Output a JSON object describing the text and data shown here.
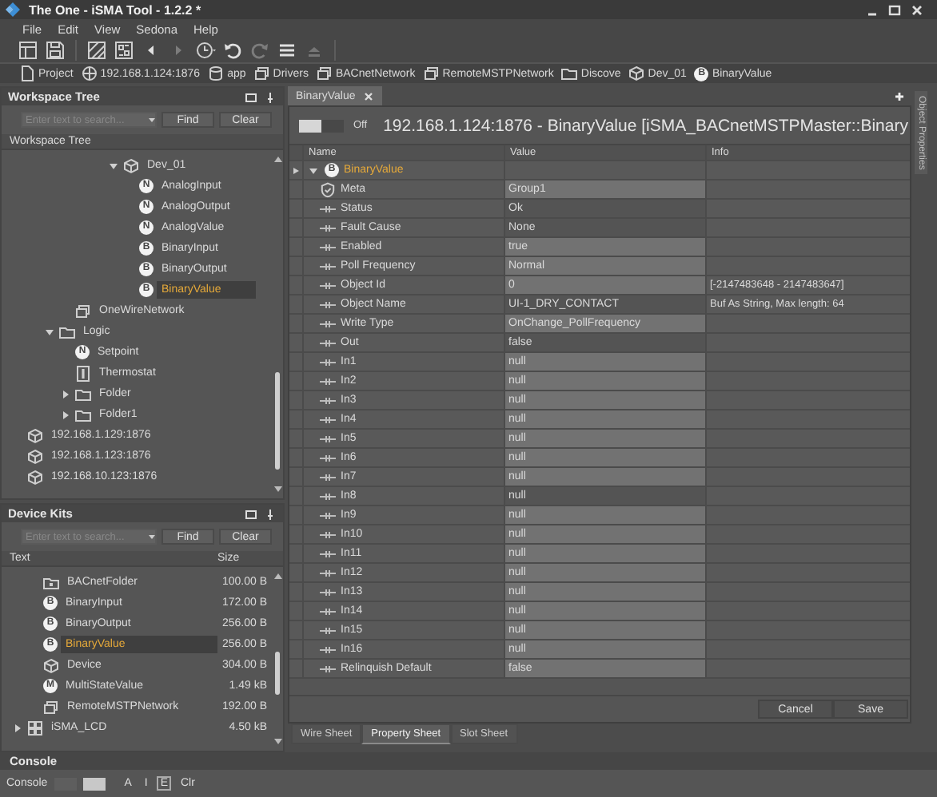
{
  "window": {
    "title": "The One - iSMA Tool - 1.2.2 *"
  },
  "menu": [
    "File",
    "Edit",
    "View",
    "Sedona",
    "Help"
  ],
  "toolbar": [
    [
      {
        "kind": "layout",
        "disabled": false
      },
      {
        "kind": "save",
        "disabled": false
      }
    ],
    [
      {
        "kind": "hatch",
        "disabled": false
      },
      {
        "kind": "chip",
        "disabled": false
      },
      {
        "kind": "back",
        "disabled": false
      },
      {
        "kind": "forward",
        "disabled": true
      },
      {
        "kind": "history",
        "disabled": false
      },
      {
        "kind": "undo",
        "disabled": false
      },
      {
        "kind": "redo",
        "disabled": true
      },
      {
        "kind": "list",
        "disabled": false
      },
      {
        "kind": "eject",
        "disabled": true
      }
    ]
  ],
  "breadcrumb": [
    {
      "kind": "page",
      "label": "Project"
    },
    {
      "kind": "station",
      "label": "192.168.1.124:1876"
    },
    {
      "kind": "database",
      "label": "app"
    },
    {
      "kind": "stack",
      "label": "Drivers"
    },
    {
      "kind": "stack",
      "label": "BACnetNetwork"
    },
    {
      "kind": "stack",
      "label": "RemoteMSTPNetwork"
    },
    {
      "kind": "folder",
      "label": "Discove"
    },
    {
      "kind": "device",
      "label": "Dev_01"
    },
    {
      "badge": "B",
      "label": "BinaryValue"
    }
  ],
  "workspace": {
    "title": "Workspace Tree",
    "search": {
      "placeholder": "Enter text to search..."
    },
    "find": "Find",
    "clear": "Clear",
    "column": "Workspace Tree",
    "tree": [
      {
        "children": [
          {
            "children": [
              {
                "children": [
                  {
                    "children": [
                      {
                        "children": [
                          {
                            "children": [
                              {
                                "label": "Dev_01",
                                "kind": "device",
                                "expanded": true,
                                "selected": false,
                                "children": [
                                  {
                                    "label": "AnalogInput",
                                    "badge": "N",
                                    "selected": false
                                  },
                                  {
                                    "label": "AnalogOutput",
                                    "badge": "N",
                                    "selected": false
                                  },
                                  {
                                    "label": "AnalogValue",
                                    "badge": "N",
                                    "selected": false
                                  },
                                  {
                                    "label": "BinaryInput",
                                    "badge": "B",
                                    "selected": false
                                  },
                                  {
                                    "label": "BinaryOutput",
                                    "badge": "B",
                                    "selected": false
                                  },
                                  {
                                    "label": "BinaryValue",
                                    "badge": "B",
                                    "selected": true
                                  }
                                ]
                              }
                            ]
                          }
                        ]
                      }
                    ]
                  },
                  {
                    "label": "OneWireNetwork",
                    "kind": "stack",
                    "selected": false
                  }
                ]
              },
              {
                "label": "Logic",
                "kind": "folder",
                "expanded": true,
                "selected": false,
                "children": [
                  {
                    "label": "Setpoint",
                    "badge": "N",
                    "selected": false
                  },
                  {
                    "label": "Thermostat",
                    "kind": "thermostat",
                    "selected": false
                  },
                  {
                    "label": "Folder",
                    "kind": "folder",
                    "expanded": false,
                    "selected": false
                  },
                  {
                    "label": "Folder1",
                    "kind": "folder",
                    "expanded": false,
                    "selected": false
                  }
                ]
              }
            ]
          }
        ]
      },
      {
        "label": "192.168.1.129:1876",
        "kind": "device",
        "selected": false
      },
      {
        "label": "192.168.1.123:1876",
        "kind": "device",
        "selected": false
      },
      {
        "label": "192.168.10.123:1876",
        "kind": "device",
        "selected": false
      }
    ]
  },
  "device_kits": {
    "title": "Device Kits",
    "search": {
      "placeholder": "Enter text to search..."
    },
    "find": "Find",
    "clear": "Clear",
    "columns": [
      "Text",
      "Size"
    ],
    "tree": [
      {
        "children": [
          {
            "label": "BACnetFolder",
            "kind": "kitfolder",
            "size": "100.00 B",
            "selected": false
          },
          {
            "label": "BinaryInput",
            "badge": "B",
            "size": "172.00 B",
            "selected": false
          },
          {
            "label": "BinaryOutput",
            "badge": "B",
            "size": "256.00 B",
            "selected": false
          },
          {
            "label": "BinaryValue",
            "badge": "B",
            "size": "256.00 B",
            "selected": true
          },
          {
            "label": "Device",
            "kind": "device",
            "size": "304.00 B",
            "selected": false
          },
          {
            "label": "MultiStateValue",
            "badge": "M",
            "size": "1.49 kB",
            "selected": false
          },
          {
            "label": "RemoteMSTPNetwork",
            "kind": "stack",
            "size": "192.00 B",
            "selected": false
          }
        ]
      },
      {
        "label": "iSMA_LCD",
        "kind": "grid",
        "size": "4.50 kB",
        "expanded": false,
        "selected": false
      }
    ]
  },
  "editor": {
    "tab": {
      "label": "BinaryValue",
      "selected": true
    },
    "toggle": {
      "on": false,
      "label": "Off"
    },
    "heading": "192.168.1.124:1876 - BinaryValue [iSMA_BACnetMSTPMaster::Binary",
    "columns": [
      "Name",
      "Value",
      "Info"
    ],
    "root": {
      "label": "BinaryValue",
      "badge": "B",
      "expanded": true
    },
    "rows": [
      {
        "name": "Meta",
        "kind": "shield",
        "value": "Group1",
        "editable": true
      },
      {
        "name": "Status",
        "kind": "slot",
        "value": "Ok",
        "editable": false
      },
      {
        "name": "Fault Cause",
        "kind": "slot",
        "value": "None",
        "editable": false
      },
      {
        "name": "Enabled",
        "kind": "slot",
        "value": "true",
        "editable": true
      },
      {
        "name": "Poll Frequency",
        "kind": "slot",
        "value": "Normal",
        "editable": true
      },
      {
        "name": "Object Id",
        "kind": "slot",
        "value": "0",
        "info": "[-2147483648 - 2147483647]",
        "editable": true
      },
      {
        "name": "Object Name",
        "kind": "slot",
        "value": "UI-1_DRY_CONTACT",
        "info": "Buf As String, Max length: 64",
        "editable": false
      },
      {
        "name": "Write Type",
        "kind": "slot",
        "value": "OnChange_PollFrequency",
        "editable": true
      },
      {
        "name": "Out",
        "kind": "slot",
        "value": "false",
        "editable": false
      },
      {
        "name": "In1",
        "kind": "slot",
        "value": "null",
        "editable": true
      },
      {
        "name": "In2",
        "kind": "slot",
        "value": "null",
        "editable": true
      },
      {
        "name": "In3",
        "kind": "slot",
        "value": "null",
        "editable": true
      },
      {
        "name": "In4",
        "kind": "slot",
        "value": "null",
        "editable": true
      },
      {
        "name": "In5",
        "kind": "slot",
        "value": "null",
        "editable": true
      },
      {
        "name": "In6",
        "kind": "slot",
        "value": "null",
        "editable": true
      },
      {
        "name": "In7",
        "kind": "slot",
        "value": "null",
        "editable": true
      },
      {
        "name": "In8",
        "kind": "slot",
        "value": "null",
        "editable": false
      },
      {
        "name": "In9",
        "kind": "slot",
        "value": "null",
        "editable": true
      },
      {
        "name": "In10",
        "kind": "slot",
        "value": "null",
        "editable": true
      },
      {
        "name": "In11",
        "kind": "slot",
        "value": "null",
        "editable": true
      },
      {
        "name": "In12",
        "kind": "slot",
        "value": "null",
        "editable": true
      },
      {
        "name": "In13",
        "kind": "slot",
        "value": "null",
        "editable": true
      },
      {
        "name": "In14",
        "kind": "slot",
        "value": "null",
        "editable": true
      },
      {
        "name": "In15",
        "kind": "slot",
        "value": "null",
        "editable": true
      },
      {
        "name": "In16",
        "kind": "slot",
        "value": "null",
        "editable": true
      },
      {
        "name": "Relinquish Default",
        "kind": "slot",
        "value": "false",
        "editable": true
      }
    ],
    "buttons": [
      "Cancel",
      "Save"
    ],
    "sheet_tabs": [
      {
        "label": "Wire Sheet",
        "selected": false
      },
      {
        "label": "Property Sheet",
        "selected": true
      },
      {
        "label": "Slot Sheet",
        "selected": false
      }
    ]
  },
  "side_panel": {
    "label": "Object Properties"
  },
  "console": {
    "title": "Console",
    "label": "Console",
    "filters": [
      {
        "label": "A",
        "selected": false
      },
      {
        "label": "I",
        "selected": false
      },
      {
        "label": "E",
        "selected": true
      }
    ],
    "clear": "Clr"
  }
}
